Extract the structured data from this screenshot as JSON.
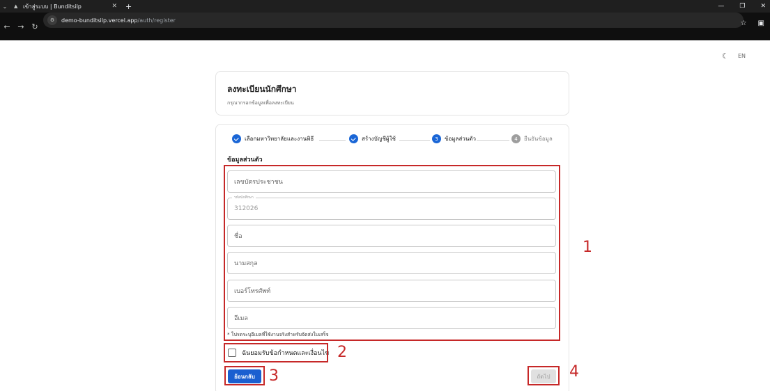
{
  "browser": {
    "tab_title": "เข้าสู่ระบบ | Bunditsilp",
    "url_host": "demo-bunditsilp.vercel.app",
    "url_path": "/auth/register"
  },
  "page": {
    "lang_toggle": "EN",
    "header": {
      "title": "ลงทะเบียนนักศึกษา",
      "subtitle": "กรุณากรอกข้อมูลเพื่อลงทะเบียน"
    },
    "steps": [
      {
        "label": "เลือกมหาวิทยาลัยและงานพิธี",
        "state": "done",
        "number": ""
      },
      {
        "label": "สร้างบัญชีผู้ใช้",
        "state": "done",
        "number": ""
      },
      {
        "label": "ข้อมูลส่วนตัว",
        "state": "active",
        "number": "3"
      },
      {
        "label": "ยืนยันข้อมูล",
        "state": "pending",
        "number": "4"
      }
    ],
    "section_title": "ข้อมูลส่วนตัว",
    "fields": {
      "citizen_id_placeholder": "เลขบัตรประชาชน",
      "student_id_label": "รหัสนักศึกษา",
      "student_id_value": "312026",
      "first_name_placeholder": "ชื่อ",
      "last_name_placeholder": "นามสกุล",
      "phone_placeholder": "เบอร์โทรศัพท์",
      "email_placeholder": "อีเมล"
    },
    "hint": "* โปรดระบุอีเมลที่ใช้งานจริงสำหรับจัดส่งใบเสร็จ",
    "terms_label": "ฉันยอมรับข้อกำหนดและเงื่อนไข",
    "back_button": "ย้อนกลับ",
    "next_button": "ถัดไป"
  },
  "annotations": [
    "1",
    "2",
    "3",
    "4"
  ],
  "colors": {
    "primary": "#1a5fd0",
    "annotation": "#c62828"
  }
}
